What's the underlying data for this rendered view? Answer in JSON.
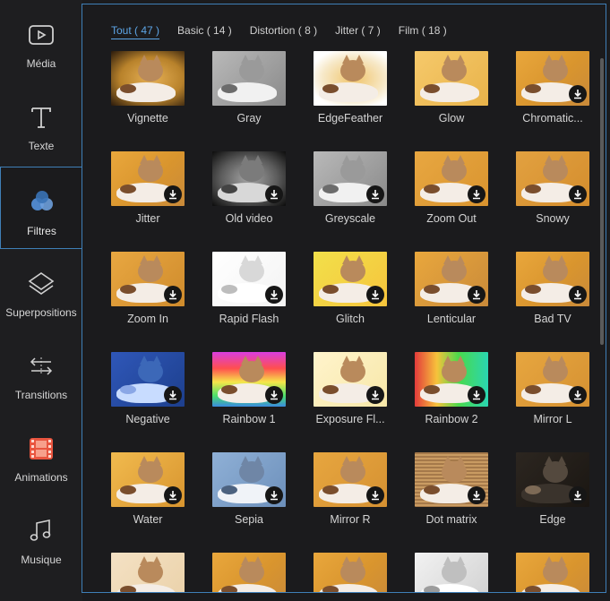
{
  "sidebar": {
    "items": [
      {
        "label": "Média",
        "icon": "media-icon"
      },
      {
        "label": "Texte",
        "icon": "text-icon"
      },
      {
        "label": "Filtres",
        "icon": "filters-icon",
        "active": true
      },
      {
        "label": "Superpositions",
        "icon": "overlays-icon"
      },
      {
        "label": "Transitions",
        "icon": "transitions-icon"
      },
      {
        "label": "Animations",
        "icon": "animations-icon"
      },
      {
        "label": "Musique",
        "icon": "music-icon"
      }
    ]
  },
  "tabs": [
    {
      "label": "Tout ( 47 )",
      "active": true
    },
    {
      "label": "Basic ( 14 )"
    },
    {
      "label": "Distortion ( 8 )"
    },
    {
      "label": "Jitter ( 7 )"
    },
    {
      "label": "Film ( 18 )"
    }
  ],
  "filters": [
    {
      "name": "Vignette",
      "style": "vignette",
      "download": false
    },
    {
      "name": "Gray",
      "style": "gray",
      "download": false
    },
    {
      "name": "EdgeFeather",
      "style": "edgefeather",
      "download": false
    },
    {
      "name": "Glow",
      "style": "glow",
      "download": false
    },
    {
      "name": "Chromatic...",
      "style": "normal",
      "download": true
    },
    {
      "name": "Jitter",
      "style": "normal",
      "download": true
    },
    {
      "name": "Old video",
      "style": "oldvideo",
      "download": true
    },
    {
      "name": "Greyscale",
      "style": "gray",
      "download": true
    },
    {
      "name": "Zoom Out",
      "style": "zoomout",
      "download": true
    },
    {
      "name": "Snowy",
      "style": "snowy",
      "download": true
    },
    {
      "name": "Zoom In",
      "style": "zoomin",
      "download": true
    },
    {
      "name": "Rapid Flash",
      "style": "flash",
      "download": true
    },
    {
      "name": "Glitch",
      "style": "glitch",
      "download": true
    },
    {
      "name": "Lenticular",
      "style": "lenticular",
      "download": true
    },
    {
      "name": "Bad TV",
      "style": "normal",
      "download": true
    },
    {
      "name": "Negative",
      "style": "negative",
      "download": true
    },
    {
      "name": "Rainbow 1",
      "style": "rainbow1",
      "download": true
    },
    {
      "name": "Exposure Fl...",
      "style": "exposure",
      "download": true
    },
    {
      "name": "Rainbow 2",
      "style": "rainbow2",
      "download": true
    },
    {
      "name": "Mirror L",
      "style": "mirror",
      "download": true
    },
    {
      "name": "Water",
      "style": "water",
      "download": true
    },
    {
      "name": "Sepia",
      "style": "sepia",
      "download": true
    },
    {
      "name": "Mirror R",
      "style": "mirror",
      "download": true
    },
    {
      "name": "Dot matrix",
      "style": "dotmatrix",
      "download": true
    },
    {
      "name": "Edge",
      "style": "edge",
      "download": true
    },
    {
      "name": "",
      "style": "pale",
      "download": false
    },
    {
      "name": "",
      "style": "normal",
      "download": false
    },
    {
      "name": "",
      "style": "normal",
      "download": false
    },
    {
      "name": "",
      "style": "grayfade",
      "download": false
    },
    {
      "name": "",
      "style": "normal",
      "download": false
    }
  ],
  "colors": {
    "accent": "#5da5e6",
    "border": "#3f7fb7",
    "background": "#1b1b1d"
  }
}
